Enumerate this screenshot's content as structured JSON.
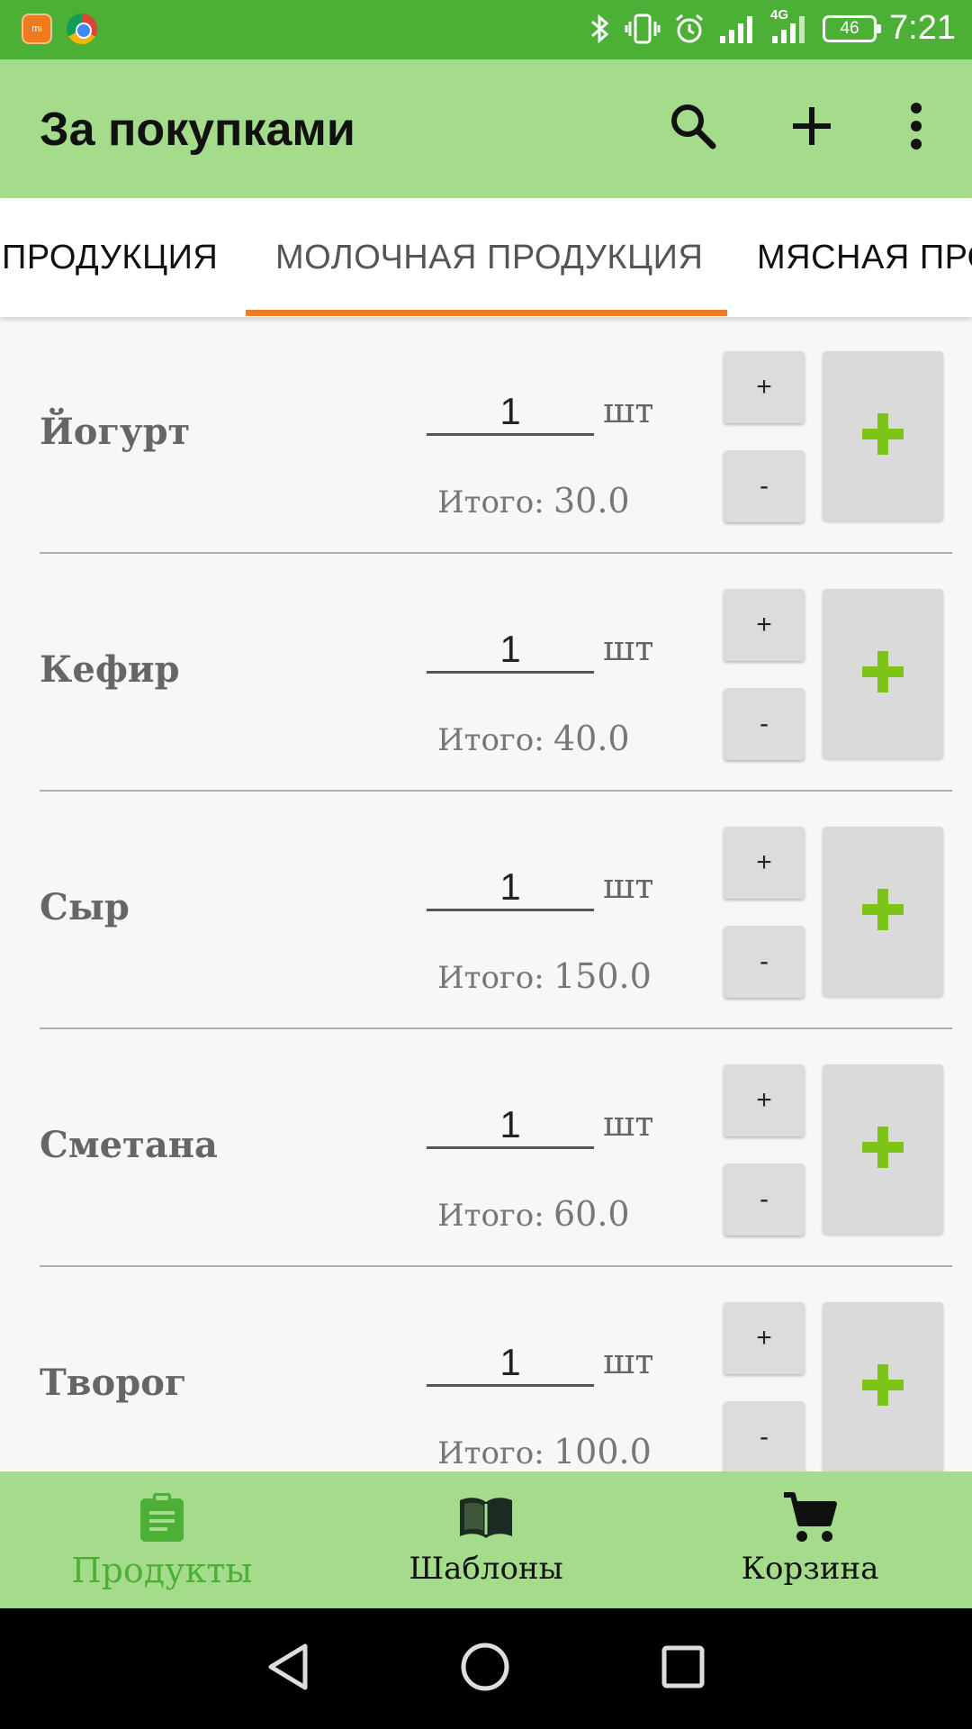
{
  "status_bar": {
    "network_type": "4G",
    "battery_level": "46",
    "time": "7:21",
    "mi_icon_text": "mi"
  },
  "app_bar": {
    "title": "За покупками",
    "actions": [
      "search-icon",
      "add-icon",
      "more-vert-icon"
    ]
  },
  "tabs": [
    {
      "label": "ПРОДУКЦИЯ"
    },
    {
      "label": "МОЛОЧНАЯ ПРОДУКЦИЯ",
      "active": true
    },
    {
      "label": "МЯСНАЯ ПРО"
    }
  ],
  "colors": {
    "status_bar": "#4caf36",
    "app_bar": "#a5dc8c",
    "tab_indicator": "#f07b20",
    "add_icon": "#7cc417",
    "active_nav": "#4caf36"
  },
  "items": [
    {
      "name": "Йогурт",
      "quantity": "1",
      "unit": "шт",
      "total_label": "Итого:",
      "total": "30.0",
      "plus_label": "+",
      "minus_label": "-"
    },
    {
      "name": "Кефир",
      "quantity": "1",
      "unit": "шт",
      "total_label": "Итого:",
      "total": "40.0",
      "plus_label": "+",
      "minus_label": "-"
    },
    {
      "name": "Сыр",
      "quantity": "1",
      "unit": "шт",
      "total_label": "Итого:",
      "total": "150.0",
      "plus_label": "+",
      "minus_label": "-"
    },
    {
      "name": "Сметана",
      "quantity": "1",
      "unit": "шт",
      "total_label": "Итого:",
      "total": "60.0",
      "plus_label": "+",
      "minus_label": "-"
    },
    {
      "name": "Творог",
      "quantity": "1",
      "unit": "шт",
      "total_label": "Итого:",
      "total": "100.0",
      "plus_label": "+",
      "minus_label": "-"
    }
  ],
  "bottom_nav": [
    {
      "label": "Продукты",
      "icon": "clipboard-icon",
      "active": true
    },
    {
      "label": "Шаблоны",
      "icon": "book-icon"
    },
    {
      "label": "Корзина",
      "icon": "cart-icon"
    }
  ],
  "system_nav": [
    "back-icon",
    "home-icon",
    "recents-icon"
  ]
}
